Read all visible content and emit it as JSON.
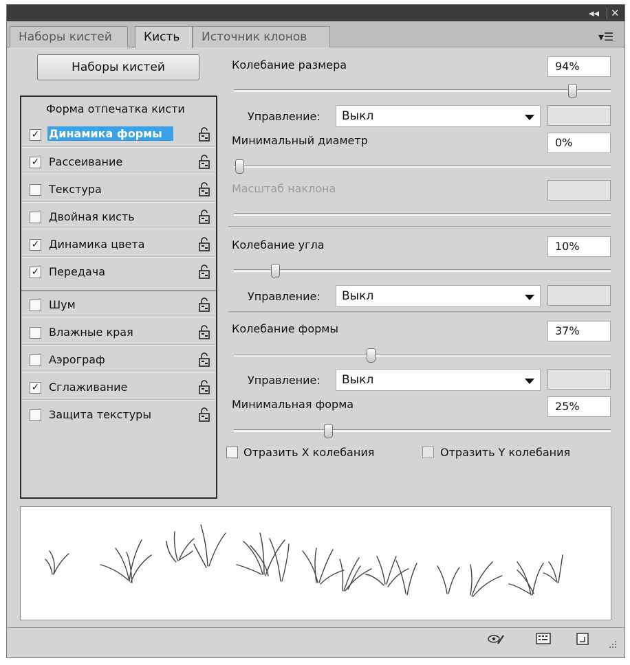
{
  "tabs": [
    {
      "label": "Наборы кистей",
      "active": false
    },
    {
      "label": "Кисть",
      "active": true
    },
    {
      "label": "Источник клонов",
      "active": false
    }
  ],
  "presets_button": "Наборы кистей",
  "options_header": "Форма отпечатка кисти",
  "options": [
    {
      "label": "Динамика формы",
      "checked": true,
      "selected": true
    },
    {
      "label": "Рассеивание",
      "checked": true
    },
    {
      "label": "Текстура",
      "checked": false
    },
    {
      "label": "Двойная кисть",
      "checked": false
    },
    {
      "label": "Динамика цвета",
      "checked": true
    },
    {
      "label": "Передача",
      "checked": true
    },
    {
      "label": "Шум",
      "checked": false
    },
    {
      "label": "Влажные края",
      "checked": false
    },
    {
      "label": "Аэрограф",
      "checked": false
    },
    {
      "label": "Сглаживание",
      "checked": true
    },
    {
      "label": "Защита текстуры",
      "checked": false
    }
  ],
  "settings": {
    "size_jitter": {
      "label": "Колебание размера",
      "value": "94%",
      "slider": 0.94
    },
    "size_control": {
      "label": "Управление:",
      "value": "Выкл"
    },
    "min_diameter": {
      "label": "Минимальный диаметр",
      "value": "0%",
      "slider": 0.0
    },
    "tilt_scale": {
      "label": "Масштаб наклона",
      "disabled": true
    },
    "angle_jitter": {
      "label": "Колебание угла",
      "value": "10%",
      "slider": 0.1
    },
    "angle_control": {
      "label": "Управление:",
      "value": "Выкл"
    },
    "roundness_jitter": {
      "label": "Колебание формы",
      "value": "37%",
      "slider": 0.37
    },
    "roundness_control": {
      "label": "Управление:",
      "value": "Выкл"
    },
    "min_roundness": {
      "label": "Минимальная форма",
      "value": "25%",
      "slider": 0.25
    },
    "flip_x": {
      "label": "Отразить X колебания",
      "checked": false
    },
    "flip_y": {
      "label": "Отразить Y колебания",
      "checked": false
    }
  },
  "icons": {
    "collapse": "double-chevron-left-icon",
    "close": "close-icon",
    "panel_menu": "panel-menu-icon",
    "lock": "lock-icon",
    "toggle_visibility": "eye-brush-icon",
    "brush_panel": "brush-panel-icon",
    "new_preset": "new-preset-icon"
  }
}
